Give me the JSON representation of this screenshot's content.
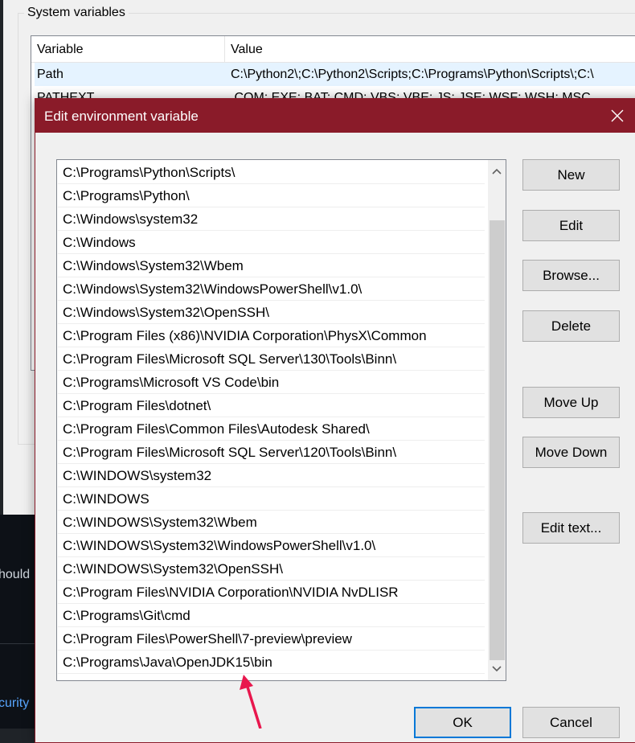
{
  "background": {
    "snippet_1": "hould",
    "snippet_2": "curity"
  },
  "parent_window": {
    "group_label": "System variables",
    "columns": [
      "Variable",
      "Value"
    ],
    "rows": [
      {
        "variable": "Path",
        "value": "C:\\Python2\\;C:\\Python2\\Scripts;C:\\Programs\\Python\\Scripts\\;C:\\"
      },
      {
        "variable": "PATHEXT",
        "value": ".COM;.EXE;.BAT;.CMD;.VBS;.VBE;.JS;.JSE;.WSF;.WSH;.MSC"
      }
    ]
  },
  "dialog": {
    "title": "Edit environment variable",
    "close_glyph": "✕",
    "paths": [
      "C:\\Programs\\Python\\Scripts\\",
      "C:\\Programs\\Python\\",
      "C:\\Windows\\system32",
      "C:\\Windows",
      "C:\\Windows\\System32\\Wbem",
      "C:\\Windows\\System32\\WindowsPowerShell\\v1.0\\",
      "C:\\Windows\\System32\\OpenSSH\\",
      "C:\\Program Files (x86)\\NVIDIA Corporation\\PhysX\\Common",
      "C:\\Program Files\\Microsoft SQL Server\\130\\Tools\\Binn\\",
      "C:\\Programs\\Microsoft VS Code\\bin",
      "C:\\Program Files\\dotnet\\",
      "C:\\Program Files\\Common Files\\Autodesk Shared\\",
      "C:\\Program Files\\Microsoft SQL Server\\120\\Tools\\Binn\\",
      "C:\\WINDOWS\\system32",
      "C:\\WINDOWS",
      "C:\\WINDOWS\\System32\\Wbem",
      "C:\\WINDOWS\\System32\\WindowsPowerShell\\v1.0\\",
      "C:\\WINDOWS\\System32\\OpenSSH\\",
      "C:\\Program Files\\NVIDIA Corporation\\NVIDIA NvDLISR",
      "C:\\Programs\\Git\\cmd",
      "C:\\Program Files\\PowerShell\\7-preview\\preview",
      "C:\\Programs\\Java\\OpenJDK15\\bin"
    ],
    "buttons": {
      "new": "New",
      "edit": "Edit",
      "browse": "Browse...",
      "delete": "Delete",
      "move_up": "Move Up",
      "move_down": "Move Down",
      "edit_text": "Edit text...",
      "ok": "OK",
      "cancel": "Cancel"
    }
  },
  "colors": {
    "titlebar": "#8a1b29",
    "annotation_arrow": "#e8174d",
    "ok_border": "#0078d7"
  },
  "icons": [
    "close-icon",
    "chevron-up-icon",
    "chevron-down-icon",
    "annotation-arrow-icon"
  ]
}
